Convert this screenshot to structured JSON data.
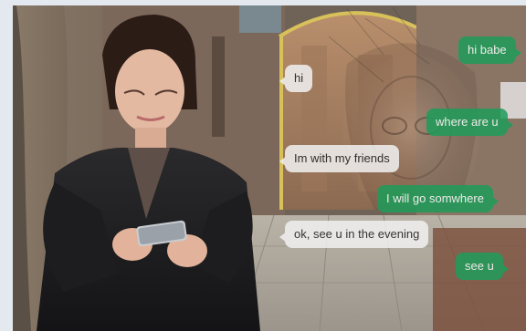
{
  "scene": {
    "description_icon": "girl-texting-photo"
  },
  "messages": [
    {
      "side": "sent",
      "text": "hi babe"
    },
    {
      "side": "received",
      "text": "hi"
    },
    {
      "side": "sent",
      "text": "where are u"
    },
    {
      "side": "received",
      "text": "Im with my friends"
    },
    {
      "side": "sent",
      "text": "I will go somwhere"
    },
    {
      "side": "received",
      "text": "ok, see u in the evening"
    },
    {
      "side": "sent",
      "text": "see u"
    }
  ],
  "colors": {
    "sent_bubble": "#1f9c5a",
    "received_bubble": "#f1f1f1"
  }
}
